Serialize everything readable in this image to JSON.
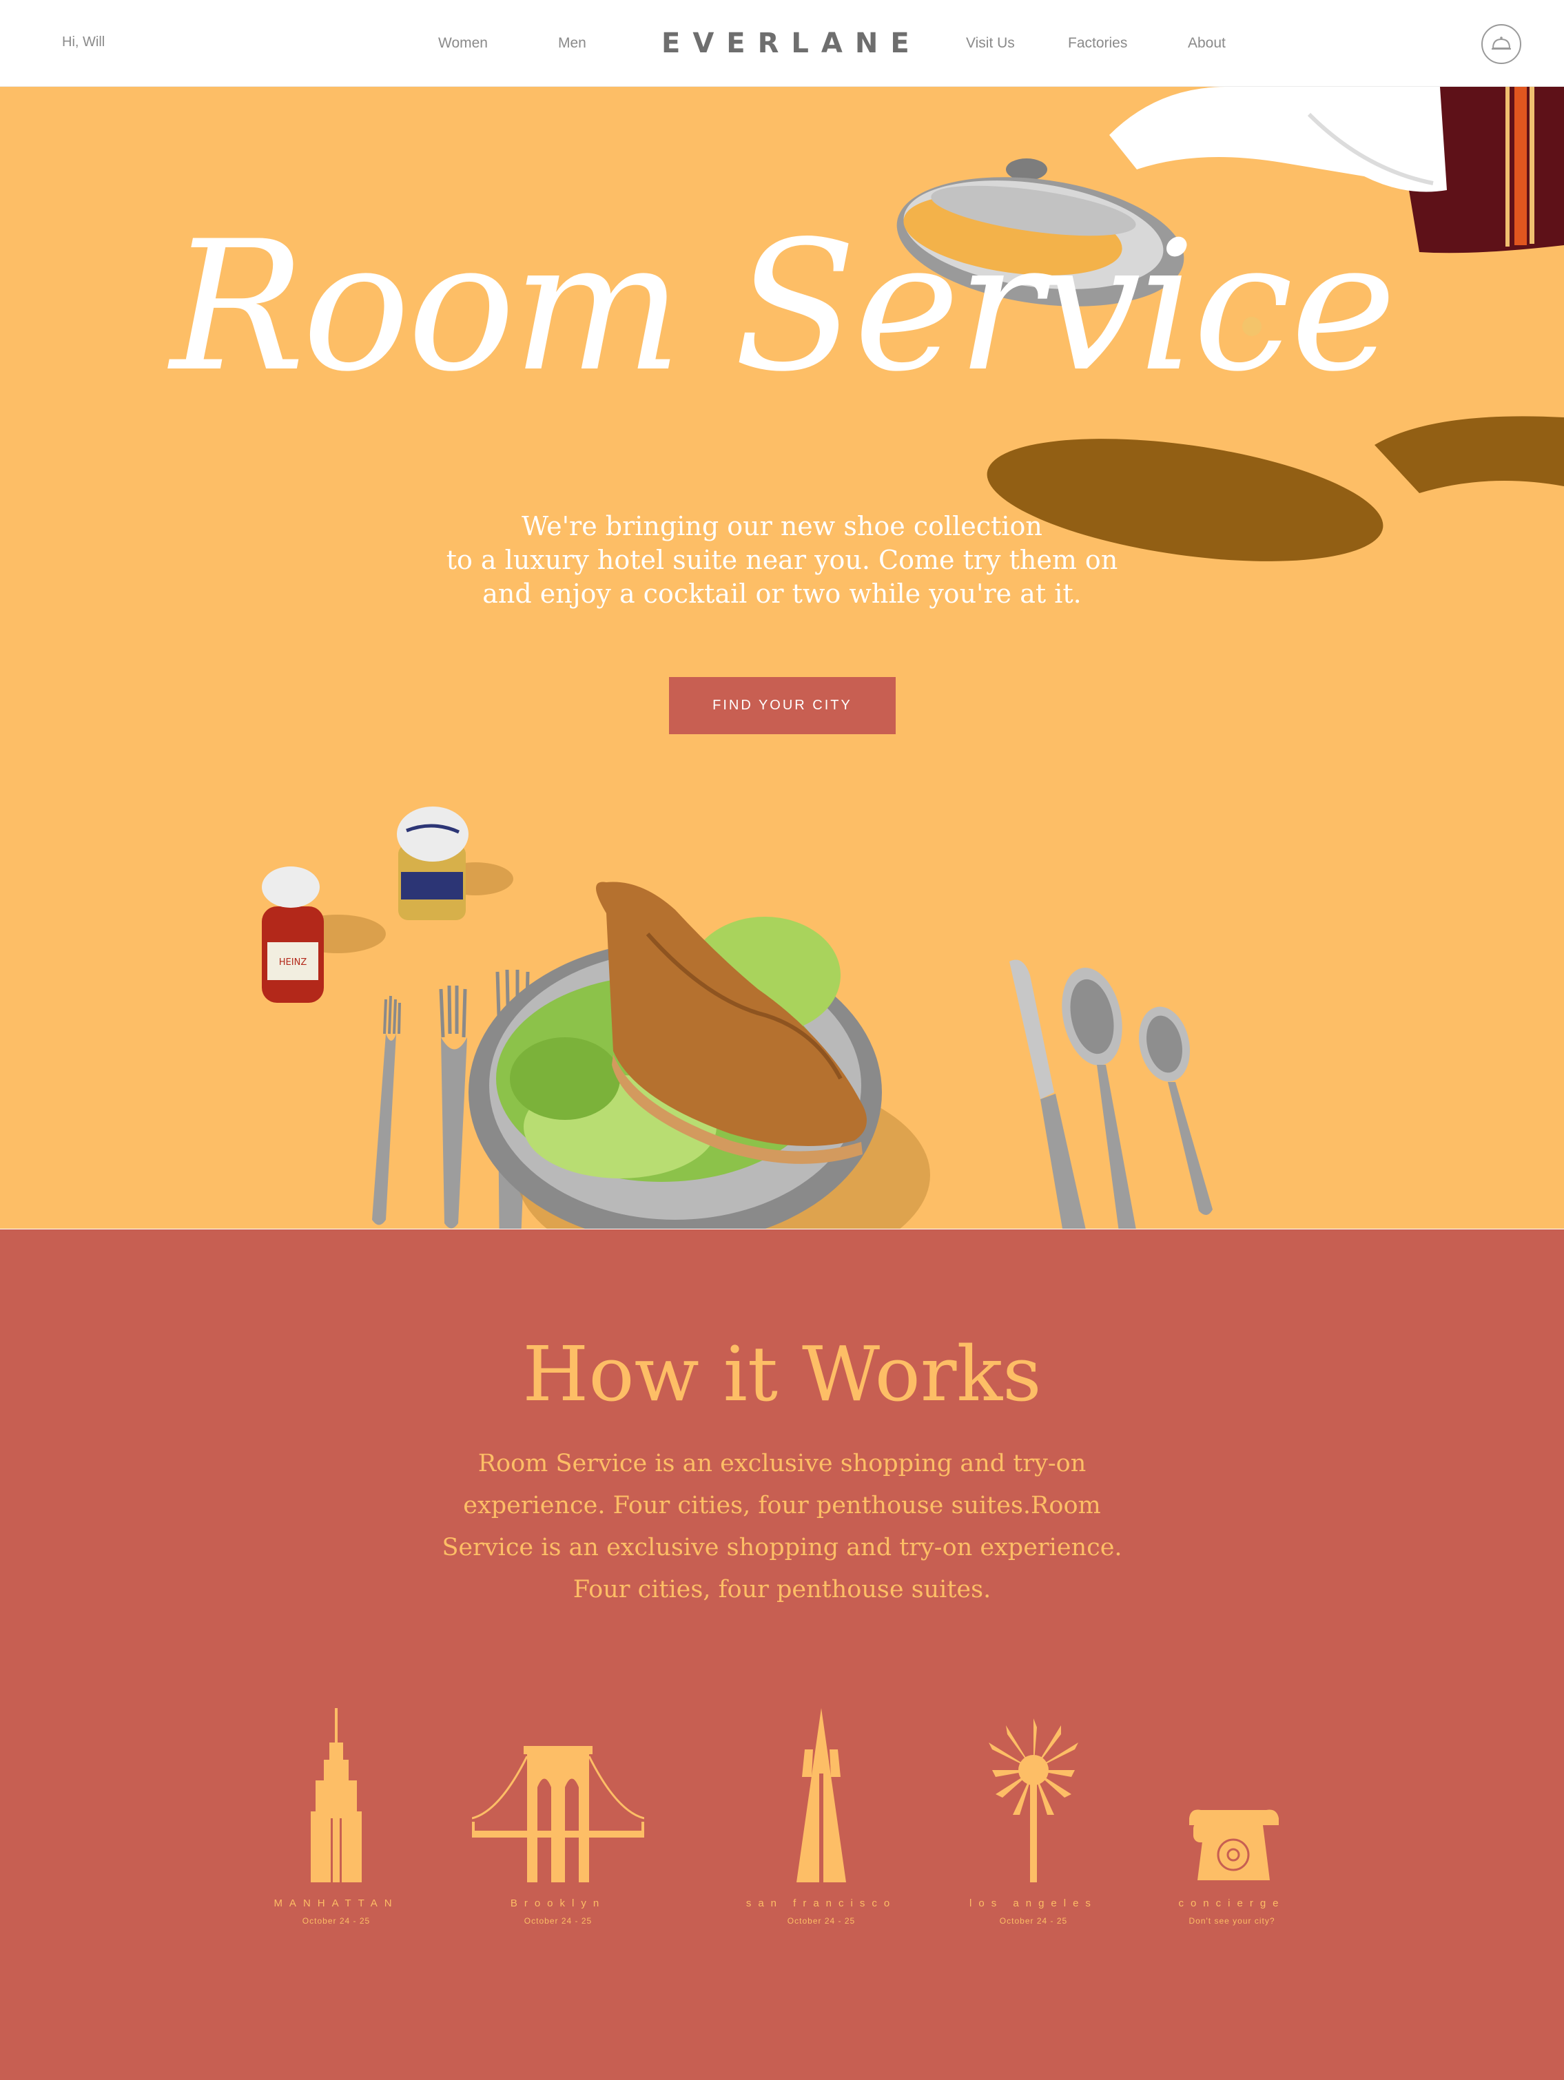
{
  "header": {
    "greeting": "Hi, Will",
    "nav_left": [
      "Women",
      "Men"
    ],
    "logo": "EVERLANE",
    "nav_right": [
      "Visit Us",
      "Factories",
      "About"
    ],
    "cart_icon": "cloche-cart-icon"
  },
  "hero": {
    "title": "Room Service",
    "subtitle_lines": [
      "We're bringing our new shoe collection",
      "to a luxury hotel suite near you. Come try them on",
      "and enjoy a cocktail or two while you're at it."
    ],
    "cta_label": "FIND YOUR CITY",
    "photo_icons": [
      "butler-cloche-icon",
      "ketchup-jar-icon",
      "mustard-jar-icon",
      "fork-icon",
      "loafer-on-plate-icon",
      "knife-icon",
      "spoon-icon"
    ]
  },
  "how_it_works": {
    "title": "How it Works",
    "body": "Room Service is an exclusive shopping and try-on experience. Four cities, four penthouse suites.Room Service is an exclusive shopping and try-on experience. Four cities, four penthouse suites.",
    "cities": [
      {
        "name": "MANHATTAN",
        "date": "October 24 - 25",
        "icon": "empire-state-icon"
      },
      {
        "name": "Brooklyn",
        "date": "October 24 - 25",
        "icon": "brooklyn-bridge-icon"
      },
      {
        "name": "san francisco",
        "date": "October 24 - 25",
        "icon": "transamerica-pyramid-icon"
      },
      {
        "name": "los angeles",
        "date": "October 24 - 25",
        "icon": "palm-tree-icon"
      },
      {
        "name": "concierge",
        "date": "Don't see your city?",
        "icon": "rotary-phone-icon"
      }
    ]
  },
  "colors": {
    "hero_bg": "#fdbe66",
    "accent": "#c85f52",
    "how_bg": "#c75f52",
    "how_text": "#fdbe66"
  }
}
